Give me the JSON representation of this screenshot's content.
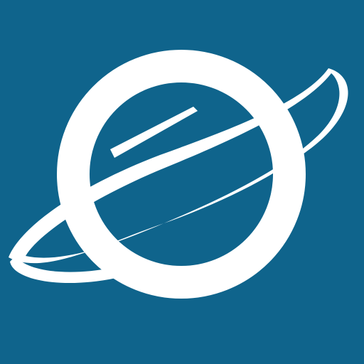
{
  "app_icon": {
    "icon": "planet-ring-icon",
    "background_color": "#0F648C",
    "foreground_color": "#FFFFFF"
  }
}
